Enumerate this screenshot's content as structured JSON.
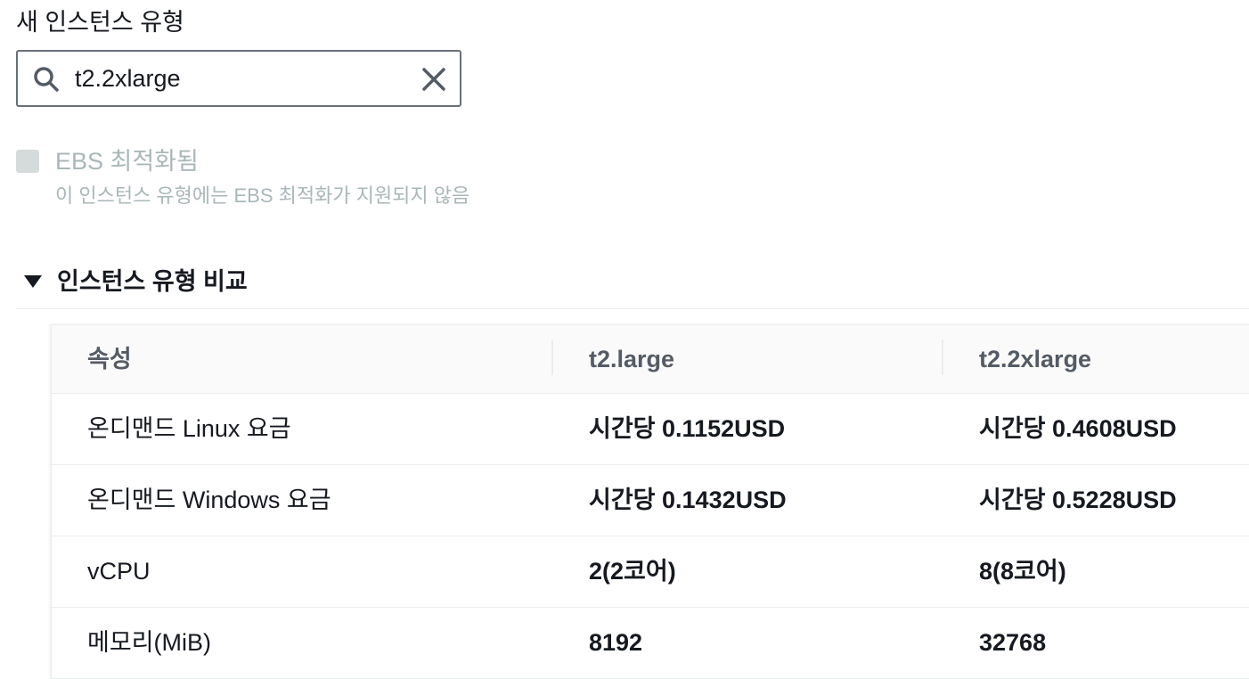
{
  "instance_type": {
    "label": "새 인스턴스 유형",
    "search_value": "t2.2xlarge",
    "icons": {
      "search": "search-icon",
      "clear": "close-icon"
    }
  },
  "ebs": {
    "label": "EBS 최적화됨",
    "description": "이 인스턴스 유형에는 EBS 최적화가 지원되지 않음",
    "checked": false,
    "disabled": true
  },
  "compare": {
    "title": "인스턴스 유형 비교",
    "expanded": true,
    "headers": [
      "속성",
      "t2.large",
      "t2.2xlarge"
    ],
    "rows": [
      {
        "attr": "온디맨드 Linux 요금",
        "current": "시간당 0.1152USD",
        "new": "시간당 0.4608USD"
      },
      {
        "attr": "온디맨드 Windows 요금",
        "current": "시간당 0.1432USD",
        "new": "시간당 0.5228USD"
      },
      {
        "attr": "vCPU",
        "current": "2(2코어)",
        "new": "8(8코어)"
      },
      {
        "attr": "메모리(MiB)",
        "current": "8192",
        "new": "32768"
      }
    ]
  },
  "colors": {
    "border": "#687078",
    "disabled": "#aab7b8",
    "header_bg": "#fafafa",
    "divider": "#eaeded"
  }
}
